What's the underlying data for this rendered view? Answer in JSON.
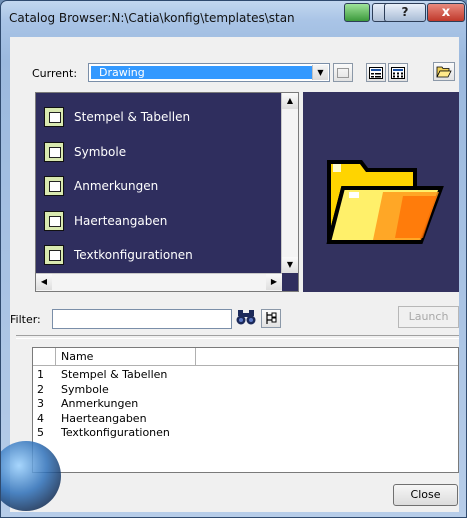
{
  "window": {
    "title": "Catalog Browser:N:\\Catia\\konfig\\templates\\stan",
    "help_label": "?",
    "close_label": "x"
  },
  "current": {
    "label": "Current:",
    "value": "Drawing",
    "arrow": "▼"
  },
  "icons": {
    "parent": "parent-folder-icon",
    "list_view": "list-view-icon",
    "details_view": "details-view-icon",
    "open_folder": "open-folder-icon",
    "search": "binoculars-icon",
    "filter_options": "filter-options-icon"
  },
  "catalog_items": [
    {
      "label": "Stempel & Tabellen"
    },
    {
      "label": "Symbole"
    },
    {
      "label": "Anmerkungen"
    },
    {
      "label": "Haerteangaben"
    },
    {
      "label": "Textkonfigurationen"
    }
  ],
  "filter": {
    "label": "Filter:",
    "value": ""
  },
  "launch_label": "Launch",
  "table": {
    "headers": [
      "",
      "Name"
    ],
    "rows": [
      {
        "num": "1",
        "name": "Stempel & Tabellen"
      },
      {
        "num": "2",
        "name": "Symbole"
      },
      {
        "num": "3",
        "name": "Anmerkungen"
      },
      {
        "num": "4",
        "name": "Haerteangaben"
      },
      {
        "num": "5",
        "name": "Textkonfigurationen"
      }
    ]
  },
  "close_label": "Close",
  "colors": {
    "list_background": "#2f2e5e",
    "selection": "#3399ff",
    "folder_yellow": "#ffd400"
  }
}
